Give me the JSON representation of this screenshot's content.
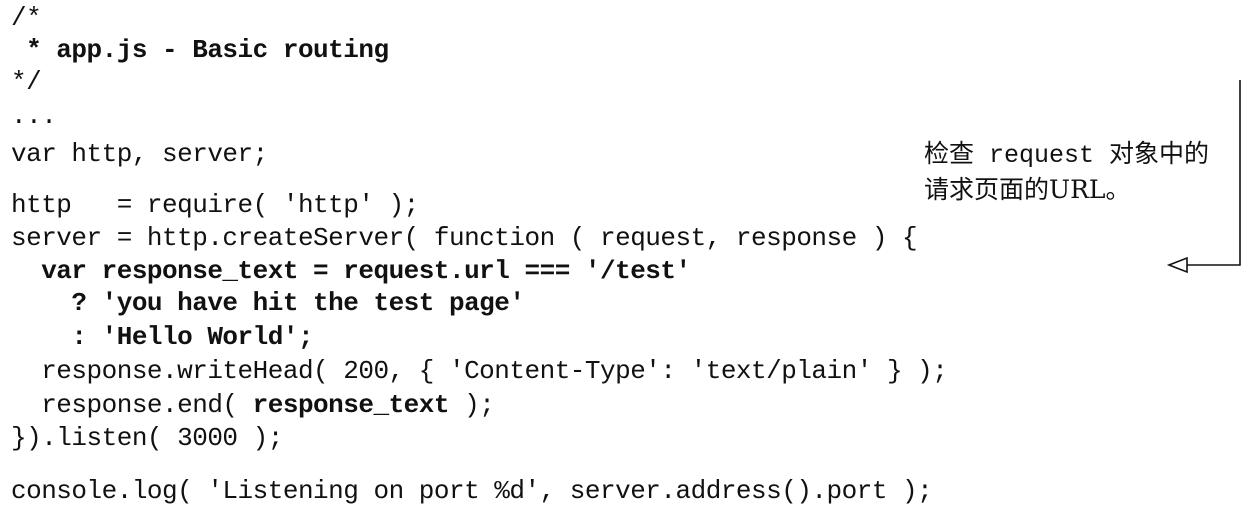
{
  "document": {
    "code_lines": [
      {
        "segments": [
          {
            "text": "/*",
            "bold": false
          }
        ]
      },
      {
        "segments": [
          {
            "text": " * app.js - Basic routing",
            "bold": true
          }
        ]
      },
      {
        "segments": [
          {
            "text": "*/",
            "bold": false
          }
        ]
      },
      {
        "segments": [
          {
            "text": "...",
            "bold": false
          }
        ]
      },
      {
        "segments": [
          {
            "text": "var http, server;",
            "bold": false
          }
        ]
      },
      {
        "segments": [
          {
            "text": "http   = require( 'http' );",
            "bold": false
          }
        ]
      },
      {
        "segments": [
          {
            "text": "server = http.createServer( function ( request, response ) {",
            "bold": false
          }
        ]
      },
      {
        "segments": [
          {
            "text": "  var response_text = request.url === '/test'",
            "bold": true
          }
        ]
      },
      {
        "segments": [
          {
            "text": "    ? 'you have hit the test page'",
            "bold": true
          }
        ]
      },
      {
        "segments": [
          {
            "text": "    : 'Hello World';",
            "bold": true
          }
        ]
      },
      {
        "segments": [
          {
            "text": "  response.writeHead( 200, { 'Content-Type': 'text/plain' } );",
            "bold": false
          }
        ]
      },
      {
        "segments": [
          {
            "text": "  response.end( ",
            "bold": false
          },
          {
            "text": "response_text",
            "bold": true
          },
          {
            "text": " );",
            "bold": false
          }
        ]
      },
      {
        "segments": [
          {
            "text": "}).listen( 3000 );",
            "bold": false
          }
        ]
      },
      {
        "segments": [
          {
            "text": "console.log( 'Listening on port %d', server.address().port );",
            "bold": false
          }
        ]
      }
    ],
    "annotation": {
      "line1_prefix": "检查",
      "line1_code": " request ",
      "line1_suffix": "对象中的",
      "line2": "请求页面的URL。"
    }
  }
}
